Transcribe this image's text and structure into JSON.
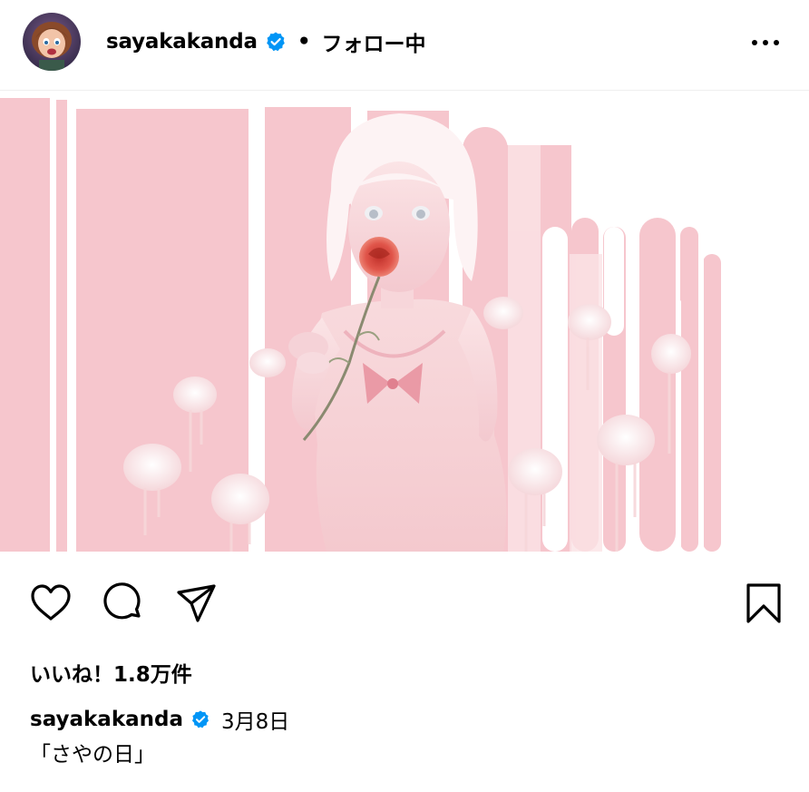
{
  "header": {
    "username": "sayakakanda",
    "separator": "•",
    "follow_status": "フォロー中",
    "avatar_icon": "avatar-illustration",
    "verified_icon": "verified-badge-icon",
    "more_icon": "more-options-icon"
  },
  "post": {
    "image_icon": "illustration-pink-flowers",
    "actions": {
      "like_icon": "heart-icon",
      "comment_icon": "comment-icon",
      "share_icon": "share-icon",
      "save_icon": "bookmark-icon"
    },
    "likes": "いいね！1.8万件",
    "caption": {
      "username": "sayakakanda",
      "date": "3月8日",
      "text": "「さやの日」"
    }
  },
  "colors": {
    "verified_blue": "#0095f6",
    "pink_background": "#f6c6cd",
    "pink_light": "#fbe3e6",
    "text": "#000000",
    "divider": "#efefef"
  }
}
